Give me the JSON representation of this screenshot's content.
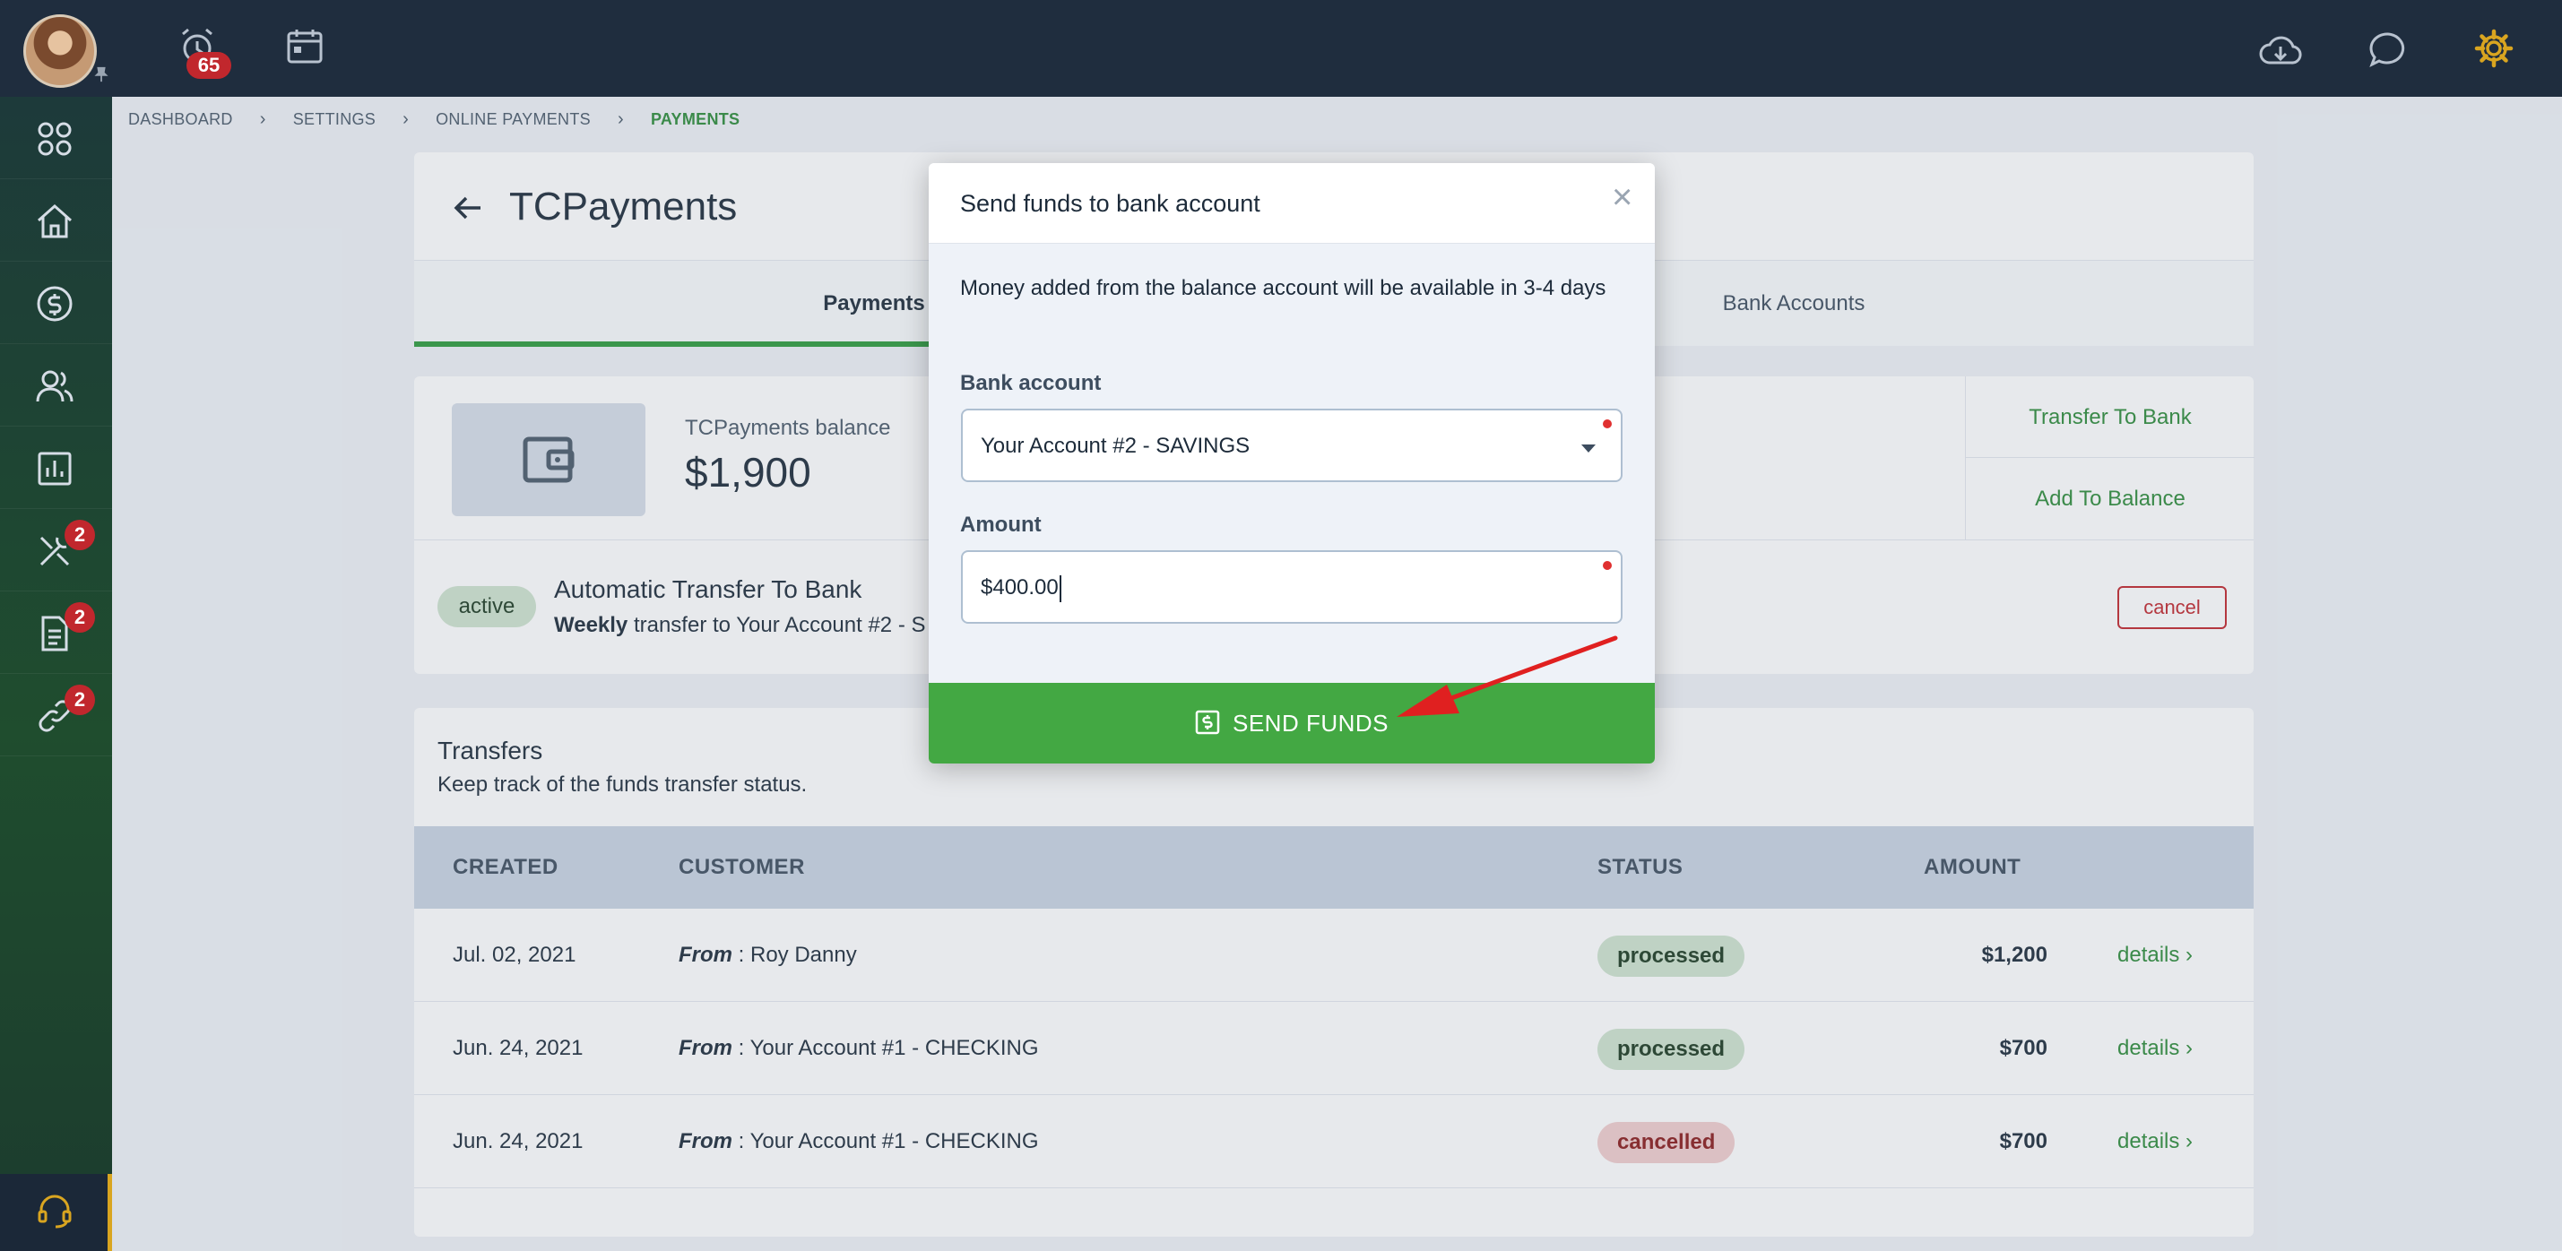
{
  "topbar": {
    "notifications_count": "65"
  },
  "sidebar": {
    "tools_badge": "2",
    "documents_badge": "2",
    "links_badge": "2"
  },
  "breadcrumb": {
    "items": [
      "DASHBOARD",
      "SETTINGS",
      "ONLINE PAYMENTS",
      "PAYMENTS"
    ]
  },
  "page": {
    "title": "TCPayments",
    "tabs": [
      "Payments",
      "Bank Accounts"
    ]
  },
  "balance": {
    "label": "TCPayments balance",
    "value": "$1,900",
    "action_transfer": "Transfer To Bank",
    "action_add": "Add To Balance",
    "status": "active",
    "auto_title": "Automatic Transfer To Bank",
    "auto_frequency": "Weekly",
    "auto_desc": " transfer to Your Account #2 - S",
    "cancel_label": "cancel"
  },
  "transfers": {
    "title": "Transfers",
    "subtitle": "Keep track of the funds transfer status.",
    "columns": [
      "CREATED",
      "CUSTOMER",
      "STATUS",
      "AMOUNT"
    ],
    "from_label": "From",
    "details_label": "details",
    "rows": [
      {
        "created": "Jul. 02, 2021",
        "customer": " : Roy Danny",
        "status": "processed",
        "amount": "$1,200"
      },
      {
        "created": "Jun. 24, 2021",
        "customer": " : Your Account #1 - CHECKING",
        "status": "processed",
        "amount": "$700"
      },
      {
        "created": "Jun. 24, 2021",
        "customer": " : Your Account #1 - CHECKING",
        "status": "cancelled",
        "amount": "$700"
      }
    ]
  },
  "modal": {
    "title": "Send funds to bank account",
    "close": "×",
    "note": "Money added from the balance account will be available in 3-4 days",
    "bank_label": "Bank account",
    "bank_value": "Your Account #2 - SAVINGS",
    "amount_label": "Amount",
    "amount_value": "$400.00",
    "send_label": "SEND FUNDS"
  },
  "colors": {
    "accent_green": "#43a843",
    "topbar": "#1f2d3e",
    "danger": "#c1272d",
    "settings_gear": "#d9a520"
  }
}
